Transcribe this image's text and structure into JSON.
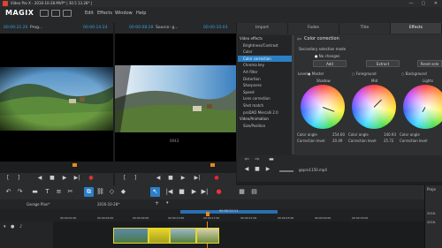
{
  "window": {
    "title": "Video Pro X - 2016-10-28.MVP* | 30.5 13.28* |",
    "min": "—",
    "max": "▢",
    "close": "✕"
  },
  "app": {
    "logo": "MAGIX"
  },
  "menu": [
    "Edit",
    "Effects",
    "Window",
    "Help"
  ],
  "monitor_left": {
    "timecode_left": "00:00:21:20",
    "name": "Prog...",
    "timecode_right": "00:00:14:24"
  },
  "monitor_right": {
    "timecode_left": "00:00:08:28",
    "name": "Source: g...",
    "timecode_right": "00:00:10:03",
    "track_label": "0043"
  },
  "tabs": [
    "Import",
    "Fades",
    "Title",
    "Effects"
  ],
  "effects_categories": [
    {
      "label": "Video effects",
      "type": "header"
    },
    {
      "label": "Brightness/Contrast",
      "type": "item"
    },
    {
      "label": "Color",
      "type": "item"
    },
    {
      "label": "Color correction",
      "type": "item",
      "selected": true
    },
    {
      "label": "Chroma key",
      "type": "item"
    },
    {
      "label": "Art filter",
      "type": "item"
    },
    {
      "label": "Distortion",
      "type": "item"
    },
    {
      "label": "Sharpness",
      "type": "item"
    },
    {
      "label": "Speed",
      "type": "item"
    },
    {
      "label": "Lens correction",
      "type": "item"
    },
    {
      "label": "Shot match",
      "type": "item"
    },
    {
      "label": "proDAD Mercalli 2.0",
      "type": "item"
    },
    {
      "label": "Video/Animation",
      "type": "header"
    },
    {
      "label": "Size/Position",
      "type": "item"
    }
  ],
  "color_correction": {
    "title": "Color correction",
    "back_icon": "back-icon",
    "secondary_label": "Secondary selection mode",
    "no_changes": "No changes",
    "add": "Add",
    "extract": "Extract",
    "reset": "Reset sele",
    "level_label": "Level",
    "master": "Master",
    "foreground": "Foreground",
    "background": "Background",
    "wheels": [
      {
        "title": "Shadow",
        "angle_label": "Color angle",
        "angle_value": "254.60",
        "level_label": "Correction level",
        "level_value": "20.49"
      },
      {
        "title": "Mid",
        "angle_label": "Color angle",
        "angle_value": "140.93",
        "level_label": "Correction level",
        "level_value": "25.72"
      },
      {
        "title": "Lights",
        "angle_label": "Color angle",
        "angle_value": "",
        "level_label": "Correction level",
        "level_value": ""
      }
    ]
  },
  "preview_footer": {
    "clip_name": "gopro1150.mp4"
  },
  "timeline": {
    "tab_label": "Garage Plan*",
    "project_label": "2016-10-28*",
    "ruler_range": "00:00:22:11",
    "ruler_marks": [
      "00:00:01:00",
      "00:00:05:00",
      "00:00:09:00",
      "00:00:13:00",
      "00:00:17:00",
      "00:00:21:00",
      "00:00:25:00",
      "00:00:29:00",
      "00:00:33:00"
    ]
  },
  "project_pane": {
    "title": "Proje",
    "item1": "2016-",
    "item2": "2016-"
  },
  "colors": {
    "accent": "#2b7fc3",
    "timecode": "#3aa0e0",
    "clip_border": "#e8d72a",
    "playhead": "#e8891a"
  }
}
